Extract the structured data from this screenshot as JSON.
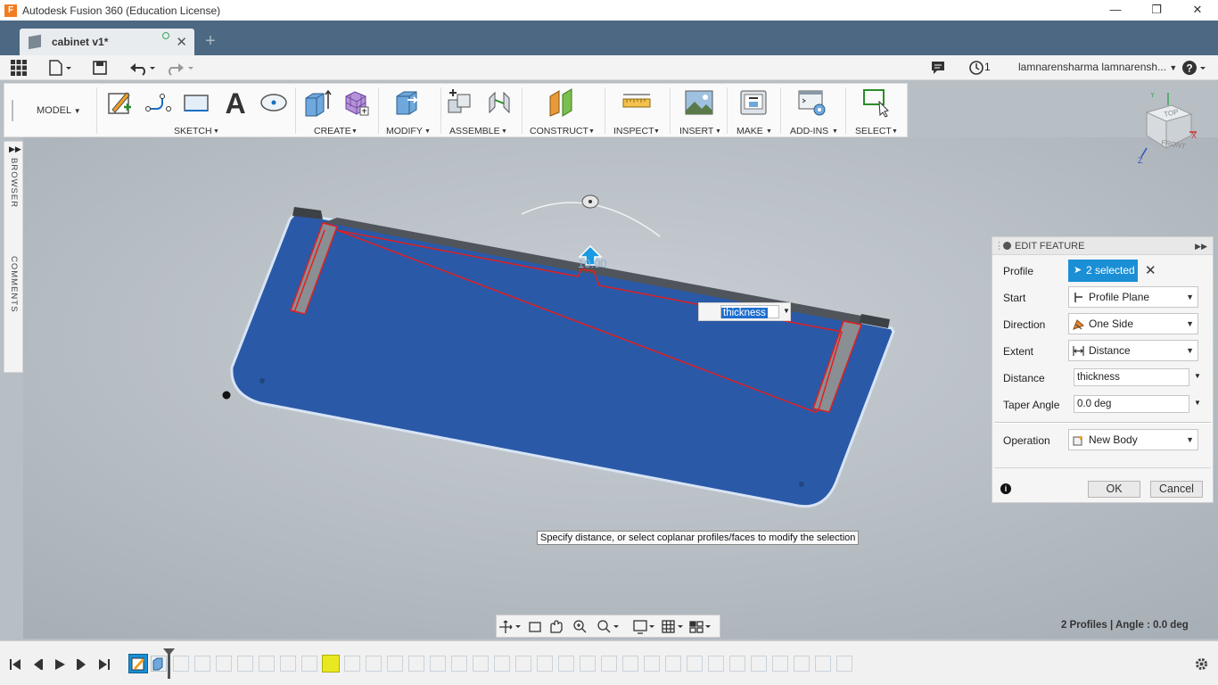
{
  "window": {
    "title": "Autodesk Fusion 360 (Education License)",
    "app_icon": "F"
  },
  "tabs": [
    {
      "label": "cabinet v1*"
    }
  ],
  "qat": {
    "jobs_count": "1",
    "user": "lamnarensharma lamnarensh..."
  },
  "ribbon": {
    "workspace": "MODEL",
    "groups": [
      "SKETCH",
      "CREATE",
      "MODIFY",
      "ASSEMBLE",
      "CONSTRUCT",
      "INSPECT",
      "INSERT",
      "MAKE",
      "ADD-INS",
      "SELECT"
    ]
  },
  "sidebar": {
    "browser": "BROWSER",
    "comments": "COMMENTS"
  },
  "viewport": {
    "distance_value": "10.00",
    "inline_input": "thickness",
    "tooltip": "Specify distance, or select coplanar profiles/faces to modify the selection",
    "status": "2 Profiles | Angle : 0.0 deg",
    "axis_labels": {
      "y": "Y",
      "x": "X",
      "z": "Z"
    },
    "viewcube": {
      "top": "TOP",
      "front": "FRONT"
    }
  },
  "edit_feature": {
    "title": "EDIT FEATURE",
    "profile_label": "Profile",
    "profile_value": "2 selected",
    "start_label": "Start",
    "start_value": "Profile Plane",
    "direction_label": "Direction",
    "direction_value": "One Side",
    "extent_label": "Extent",
    "extent_value": "Distance",
    "distance_label": "Distance",
    "distance_value": "thickness",
    "taper_label": "Taper Angle",
    "taper_value": "0.0 deg",
    "operation_label": "Operation",
    "operation_value": "New Body",
    "ok": "OK",
    "cancel": "Cancel"
  },
  "colors": {
    "accent": "#1a8fd6",
    "body_blue": "#2a59a8",
    "tabbar": "#4c6882"
  }
}
